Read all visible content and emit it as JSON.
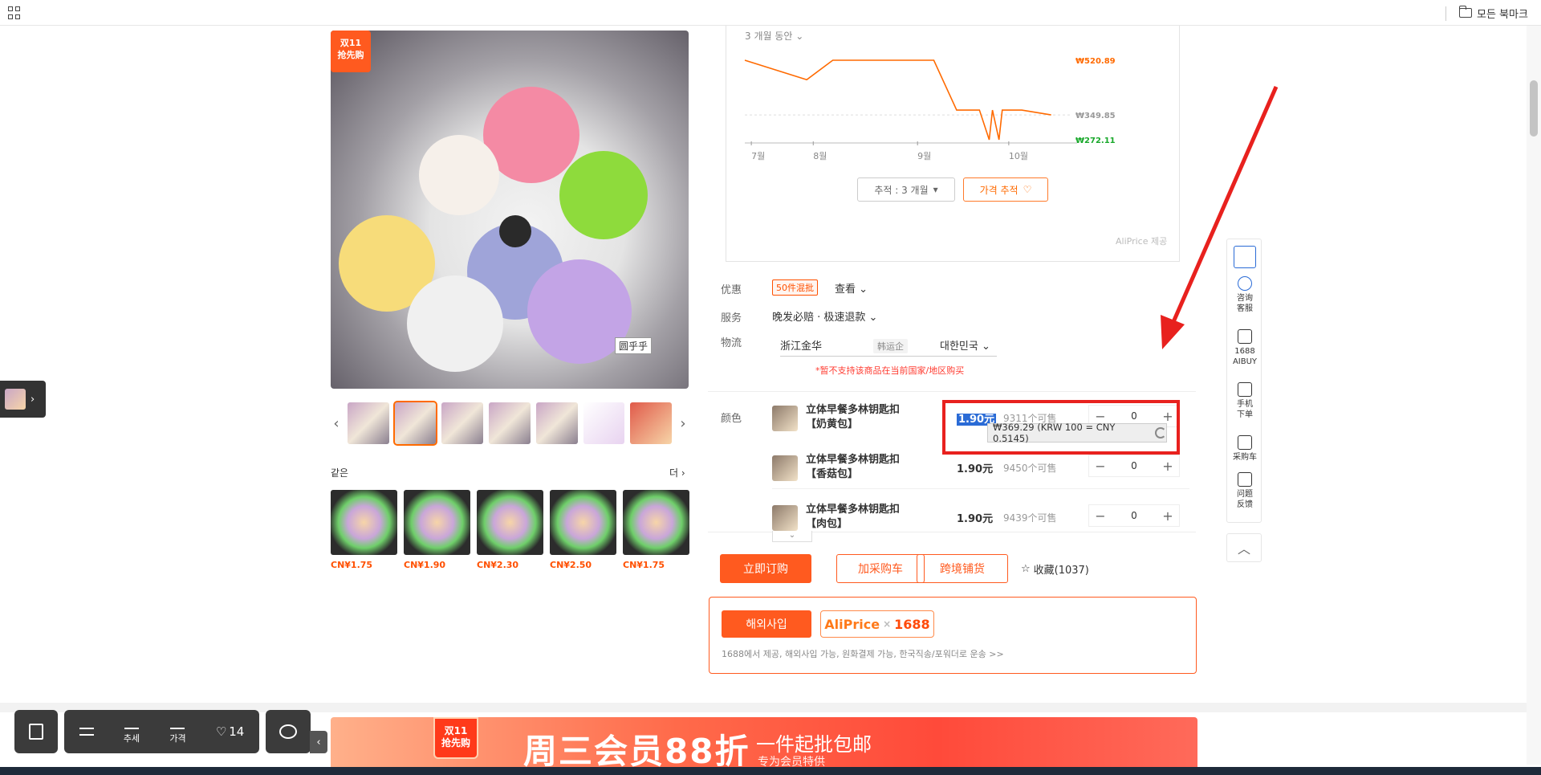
{
  "bookmarks": {
    "label": "모든 북마크"
  },
  "product": {
    "badge": "双11\n抢先购",
    "image_caption": "圆乎乎",
    "similar_title": "같은",
    "similar_more": "더",
    "similar_prices": [
      "CN¥1.75",
      "CN¥1.90",
      "CN¥2.30",
      "CN¥2.50",
      "CN¥1.75"
    ]
  },
  "chart": {
    "period_label": "3 개월 동안",
    "track_button": "추적 : 3 개월",
    "alert_button": "가격 추적",
    "provider": "AliPrice 제공"
  },
  "chart_data": {
    "type": "line",
    "title": "",
    "xlabel": "",
    "ylabel": "",
    "x_ticks": [
      "7월",
      "8월",
      "9월",
      "10월"
    ],
    "price_labels": {
      "max": "₩520.89",
      "current": "₩349.85",
      "min": "₩272.11"
    },
    "series": [
      {
        "values": [
          {
            "x": "7월 초",
            "y": 520.89
          },
          {
            "x": "8월 초",
            "y": 460
          },
          {
            "x": "8월 중순",
            "y": 520.89
          },
          {
            "x": "9월 초",
            "y": 520.89
          },
          {
            "x": "9월 하순",
            "y": 365
          },
          {
            "x": "9월 말",
            "y": 365
          },
          {
            "x": "10월 초",
            "y": 272.11
          },
          {
            "x": "10월 초",
            "y": 365
          },
          {
            "x": "10월 초",
            "y": 272.11
          },
          {
            "x": "10월 초",
            "y": 365
          },
          {
            "x": "10월 중순",
            "y": 365
          },
          {
            "x": "10월 하순",
            "y": 349.85
          }
        ]
      }
    ],
    "colors": {
      "line": "#ff6a00",
      "max_label": "#ff6a00",
      "current_label": "#999999",
      "min_label": "#18a82a"
    }
  },
  "details": {
    "promo_label": "优惠",
    "promo_tag": "50件混批",
    "promo_view": "查看",
    "service_label": "服务",
    "service_text": "晚发必赔 · 极速退款",
    "logistics_label": "物流",
    "from": "浙江金华",
    "carrier": "韩运企",
    "to": "대한민국",
    "warning": "*暂不支持该商品在当前国家/地区购买",
    "color_label": "颜色"
  },
  "variants": [
    {
      "name": "立体早餐多林钥匙扣【奶黄包】",
      "price": "1.90元",
      "stock": "9311个可售",
      "qty": "0"
    },
    {
      "name": "立体早餐多林钥匙扣【香菇包】",
      "price": "1.90元",
      "stock": "9450个可售",
      "qty": "0"
    },
    {
      "name": "立体早餐多林钥匙扣【肉包】",
      "price": "1.90元",
      "stock": "9439个可售",
      "qty": "0"
    }
  ],
  "tooltip": {
    "text": "₩369.29 (KRW 100 = CNY 0.5145)"
  },
  "actions": {
    "buy": "立即订购",
    "cart": "加采购车",
    "cross": "跨境铺货",
    "favorite": "收藏(1037)"
  },
  "overseas": {
    "button": "해외사입",
    "brand_a": "AliPrice",
    "brand_x": "×",
    "brand_n": "1688",
    "desc": "1688에서 제공, 해외사입 가능, 원화결제 가능, 한국직송/포워더로 운송 >>"
  },
  "toolbar": {
    "consult": "咨询\n客服",
    "aibuy": "1688\nAIBUY",
    "mobile": "手机\n下单",
    "cart": "采购车",
    "feedback": "问题\n反馈"
  },
  "dock": {
    "trend": "추세",
    "price": "가격",
    "likes": "14"
  },
  "banner": {
    "badge": "双11\n抢先购",
    "title": "周三会员88折",
    "sub": "一件起批包邮",
    "sub2": "专为会员特供"
  }
}
